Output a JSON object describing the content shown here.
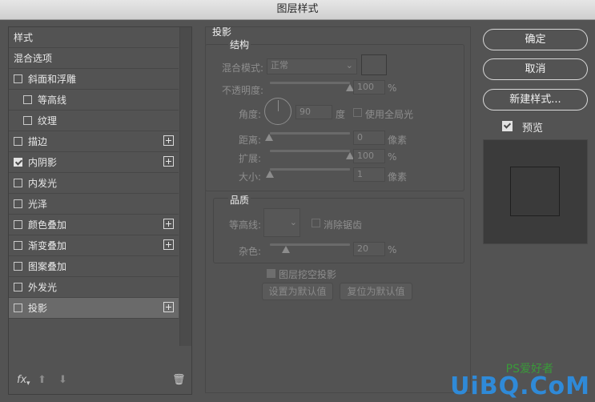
{
  "window": {
    "title": "图层样式"
  },
  "left_panel": {
    "items": [
      {
        "label": "样式",
        "checkbox": false,
        "checked": false,
        "plus": false,
        "indent": false,
        "selected": false
      },
      {
        "label": "混合选项",
        "checkbox": false,
        "checked": false,
        "plus": false,
        "indent": false,
        "selected": false
      },
      {
        "label": "斜面和浮雕",
        "checkbox": true,
        "checked": false,
        "plus": false,
        "indent": false,
        "selected": false
      },
      {
        "label": "等高线",
        "checkbox": true,
        "checked": false,
        "plus": false,
        "indent": true,
        "selected": false
      },
      {
        "label": "纹理",
        "checkbox": true,
        "checked": false,
        "plus": false,
        "indent": true,
        "selected": false
      },
      {
        "label": "描边",
        "checkbox": true,
        "checked": false,
        "plus": true,
        "indent": false,
        "selected": false
      },
      {
        "label": "内阴影",
        "checkbox": true,
        "checked": true,
        "plus": true,
        "indent": false,
        "selected": false
      },
      {
        "label": "内发光",
        "checkbox": true,
        "checked": false,
        "plus": false,
        "indent": false,
        "selected": false
      },
      {
        "label": "光泽",
        "checkbox": true,
        "checked": false,
        "plus": false,
        "indent": false,
        "selected": false
      },
      {
        "label": "颜色叠加",
        "checkbox": true,
        "checked": false,
        "plus": true,
        "indent": false,
        "selected": false
      },
      {
        "label": "渐变叠加",
        "checkbox": true,
        "checked": false,
        "plus": true,
        "indent": false,
        "selected": false
      },
      {
        "label": "图案叠加",
        "checkbox": true,
        "checked": false,
        "plus": false,
        "indent": false,
        "selected": false
      },
      {
        "label": "外发光",
        "checkbox": true,
        "checked": false,
        "plus": false,
        "indent": false,
        "selected": false
      },
      {
        "label": "投影",
        "checkbox": true,
        "checked": false,
        "plus": true,
        "indent": false,
        "selected": true
      }
    ],
    "fx_label": "fx"
  },
  "drop_shadow": {
    "section_title": "投影",
    "structure": {
      "title": "结构",
      "blend_mode_label": "混合模式:",
      "blend_mode_value": "正常",
      "opacity_label": "不透明度:",
      "opacity_value": "100",
      "opacity_percent": 100,
      "angle_label": "角度:",
      "angle_value": "90",
      "angle_unit": "度",
      "global_light_label": "使用全局光",
      "distance_label": "距离:",
      "distance_value": "0",
      "distance_unit": "像素",
      "spread_label": "扩展:",
      "spread_value": "100",
      "spread_percent": 100,
      "size_label": "大小:",
      "size_value": "1",
      "size_unit": "像素",
      "percent_sign": "%"
    },
    "quality": {
      "title": "品质",
      "contour_label": "等高线:",
      "anti_alias_label": "消除锯齿",
      "noise_label": "杂色:",
      "noise_value": "20",
      "noise_percent": 20,
      "percent_sign": "%"
    },
    "knockout_label": "图层挖空投影",
    "knockout_checked": true,
    "make_default_label": "设置为默认值",
    "reset_default_label": "复位为默认值"
  },
  "right_panel": {
    "ok_label": "确定",
    "cancel_label": "取消",
    "new_style_label": "新建样式...",
    "preview_label": "预览",
    "preview_checked": true
  },
  "watermark": {
    "text": "UiBQ.CoM",
    "sub": "PS爱好者"
  },
  "colors": {
    "background": "#535353",
    "selected_row": "#6a6a6a",
    "watermark": "#2f8ad8"
  }
}
